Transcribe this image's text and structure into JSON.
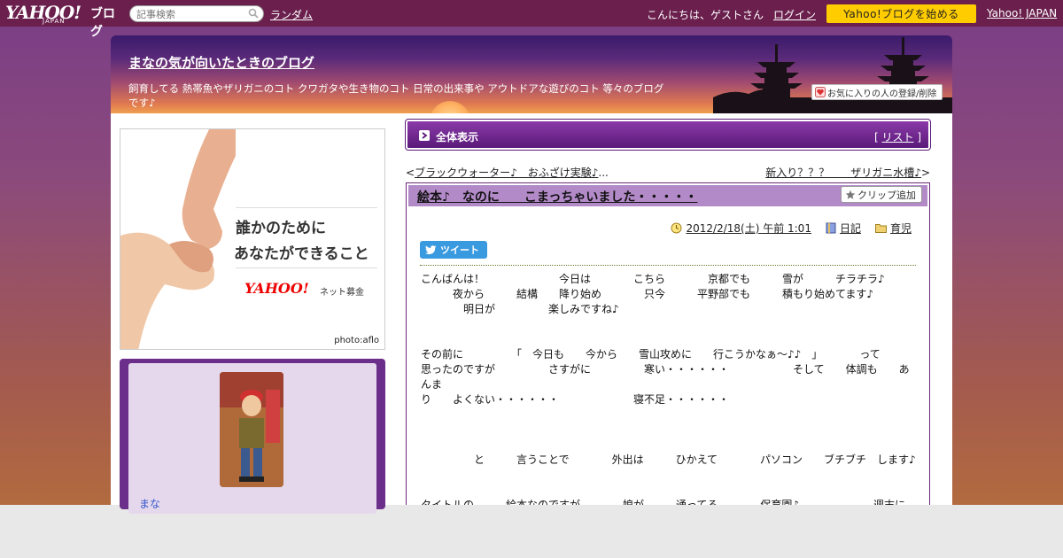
{
  "topbar": {
    "logo_main": "YAHOO!",
    "logo_sub": "JAPAN",
    "logo_blog": "ブログ",
    "search_placeholder": "記事検索",
    "random_label": "ランダム",
    "greeting": "こんにちは、ゲストさん",
    "login_label": "ログイン",
    "start_label": "Yahoo!ブログを始める",
    "yahoo_japan_label": "Yahoo! JAPAN"
  },
  "header": {
    "title": "まなの気が向いたときのブログ",
    "description": "飼育してる 熱帯魚やザリガニのコト クワガタや生き物のコト 日常の出来事や アウトドアな遊びのコト 等々のブログです♪",
    "fav_label": "お気に入りの人の登録/削除"
  },
  "ad": {
    "line1": "誰かのために",
    "line2": "あなたができること",
    "logo": "YAHOO!",
    "logo_sub": "ネット募金",
    "credit": "photo:aflo"
  },
  "profile": {
    "name": "まな"
  },
  "all_bar": {
    "title": "全体表示",
    "list_open": "[ ",
    "list_label": "リスト",
    "list_close": " ]"
  },
  "nav": {
    "prev_open": "<",
    "prev_label": "ブラックウォーター♪　おふざけ実験♪",
    "prev_ellipsis": "...",
    "next_label": "新入り？？？　　ザリガニ水槽♪",
    "next_close": ">"
  },
  "article": {
    "title": "絵本♪　なのに　　こまっちゃいました・・・・・",
    "clip_label": "クリップ追加",
    "date": "2012/2/18(土) 午前 1:01",
    "category1": "日記",
    "category2": "育児",
    "tweet_label": "ツイート",
    "body": "こんばんは！　　　　　　　今日は　　　　こちら　　　　京都でも　　　雪が　　　チラチラ♪\n　　　夜から　　　結構　　降り始め　　　　只今　　　平野部でも　　　積もり始めてます♪\n　　　　明日が　　　　　楽しみですね♪\n\n\nその前に　　　　　「　今日も　　今から　　雪山攻めに　　行こうかなぁ～♪♪　」　　　　って\n思ったのですが　　　　　さすがに　　　　　寒い・・・・・・　　　　　　そして　　体調も　　あんま\nり　　よくない・・・・・・　　　　　　　寝不足・・・・・・\n\n\n\n　　　　　と　　　言うことで　　　　外出は　　　ひかえて　　　　パソコン　　ブチブチ　します♪\n\n\nタイトルの　　　絵本なのですが　　　　娘が　　　通ってる　　　　保育園♪　　　　　　　週末に\n　　　絵本が　　　借りられます♪　　　　　　　　毎週　　　借りて帰って　　　　　夜　寝る前\nに　　　絵本を　　　　読みます♪　　　　　　まぁ　　　毎日　　　なにかしら　　　　寝る前\nは　　　　　　絵本を　　　読みます♪　　　ほぼ　　嫁さんですが・・・・・・"
  },
  "colors": {
    "topbar": "#6a1f4d",
    "start_button": "#ffcc00",
    "accent_purple": "#6b2e8a",
    "title_bar": "#b38ac8",
    "tweet": "#3a9ae0"
  }
}
